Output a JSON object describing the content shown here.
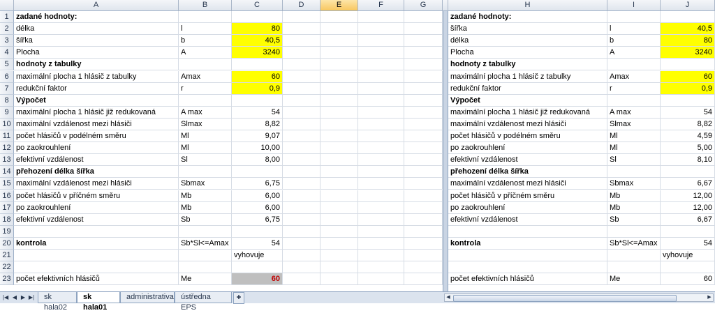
{
  "columns_left": [
    "A",
    "B",
    "C",
    "D",
    "E",
    "F",
    "G"
  ],
  "columns_right": [
    "H",
    "I",
    "J"
  ],
  "selected_column": "E",
  "rows": [
    {
      "n": "1",
      "A": "zadané hodnoty:",
      "B": "",
      "C": "",
      "H": "zadané hodnoty:",
      "I": "",
      "J": "",
      "boldA": true,
      "boldH": true
    },
    {
      "n": "2",
      "A": "délka",
      "B": "l",
      "C": "80",
      "H": "šířka",
      "I": "l",
      "J": "40,5",
      "yellowC": true,
      "yellowJ": true
    },
    {
      "n": "3",
      "A": "šířka",
      "B": "b",
      "C": "40,5",
      "H": "délka",
      "I": "b",
      "J": "80",
      "yellowC": true,
      "yellowJ": true
    },
    {
      "n": "4",
      "A": "Plocha",
      "B": "A",
      "C": "3240",
      "H": "Plocha",
      "I": "A",
      "J": "3240",
      "yellowC": true,
      "yellowJ": true
    },
    {
      "n": "5",
      "A": "hodnoty z tabulky",
      "B": "",
      "C": "",
      "H": "hodnoty z tabulky",
      "I": "",
      "J": "",
      "boldA": true,
      "boldH": true
    },
    {
      "n": "6",
      "A": "maximální plocha 1 hlásič z tabulky",
      "B": "Amax",
      "C": "60",
      "H": "maximální plocha 1 hlásič z tabulky",
      "I": "Amax",
      "J": "60",
      "yellowC": true,
      "yellowJ": true
    },
    {
      "n": "7",
      "A": "redukční faktor",
      "B": "r",
      "C": "0,9",
      "H": "redukční faktor",
      "I": "r",
      "J": "0,9",
      "yellowC": true,
      "yellowJ": true
    },
    {
      "n": "8",
      "A": "Výpočet",
      "B": "",
      "C": "",
      "H": "Výpočet",
      "I": "",
      "J": "",
      "boldA": true,
      "boldH": true
    },
    {
      "n": "9",
      "A": "maximální plocha 1 hlásič již redukovaná",
      "B": "A max",
      "C": "54",
      "H": "maximální plocha 1 hlásič již redukovaná",
      "I": "A max",
      "J": "54"
    },
    {
      "n": "10",
      "A": "maximální vzdálenost mezi hlásiči",
      "B": "Slmax",
      "C": "8,82",
      "H": "maximální vzdálenost mezi hlásiči",
      "I": "Slmax",
      "J": "8,82"
    },
    {
      "n": "11",
      "A": "počet hlásičů v podélném směru",
      "B": "Ml",
      "C": "9,07",
      "H": "počet hlásičů v podélném směru",
      "I": "Ml",
      "J": "4,59"
    },
    {
      "n": "12",
      "A": "po zaokrouhlení",
      "B": "Ml",
      "C": "10,00",
      "H": "po zaokrouhlení",
      "I": "Ml",
      "J": "5,00"
    },
    {
      "n": "13",
      "A": "efektivní vzdálenost",
      "B": "Sl",
      "C": "8,00",
      "H": "efektivní vzdálenost",
      "I": "Sl",
      "J": "8,10"
    },
    {
      "n": "14",
      "A": "přehození délka šířka",
      "B": "",
      "C": "",
      "H": "přehození délka šířka",
      "I": "",
      "J": "",
      "boldA": true,
      "boldH": true
    },
    {
      "n": "15",
      "A": "maximální vzdálenost mezi hlásiči",
      "B": "Sbmax",
      "C": "6,75",
      "H": "maximální vzdálenost mezi hlásiči",
      "I": "Sbmax",
      "J": "6,67"
    },
    {
      "n": "16",
      "A": "počet hlásičů v příčném směru",
      "B": "Mb",
      "C": "6,00",
      "H": "počet hlásičů v příčném směru",
      "I": "Mb",
      "J": "12,00"
    },
    {
      "n": "17",
      "A": "po zaokrouhlení",
      "B": "Mb",
      "C": "6,00",
      "H": "po zaokrouhlení",
      "I": "Mb",
      "J": "12,00"
    },
    {
      "n": "18",
      "A": "efektivní vzdálenost",
      "B": "Sb",
      "C": "6,75",
      "H": "efektivní vzdálenost",
      "I": "Sb",
      "J": "6,67"
    },
    {
      "n": "19",
      "A": "",
      "B": "",
      "C": "",
      "H": "",
      "I": "",
      "J": ""
    },
    {
      "n": "20",
      "A": "kontrola",
      "B": "Sb*Sl<=Amax",
      "C": "54",
      "H": "kontrola",
      "I": "Sb*Sl<=Amax",
      "J": "54",
      "boldA": true,
      "boldH": true
    },
    {
      "n": "21",
      "A": "",
      "B": "",
      "C": "vyhovuje",
      "H": "",
      "I": "",
      "J": "vyhovuje",
      "textC": true,
      "textJ": true
    },
    {
      "n": "22",
      "A": "",
      "B": "",
      "C": "",
      "H": "",
      "I": "",
      "J": ""
    },
    {
      "n": "23",
      "A": "počet efektivních hlásičů",
      "B": "Me",
      "C": "60",
      "H": "počet efektivních hlásičů",
      "I": "Me",
      "J": "60",
      "grayC": true
    }
  ],
  "sheet_tabs": [
    {
      "label": "sk hala02",
      "active": false
    },
    {
      "label": "sk hala01",
      "active": true
    },
    {
      "label": "administrativa",
      "active": false
    },
    {
      "label": "ústředna EPS",
      "active": false
    }
  ],
  "nav_buttons": [
    "first-sheet",
    "prev-sheet",
    "next-sheet",
    "last-sheet"
  ],
  "colors": {
    "yellow": "#ffff00",
    "gray": "#bfbfbf",
    "red_text": "#c00000",
    "selected_header": "#f8c760"
  }
}
